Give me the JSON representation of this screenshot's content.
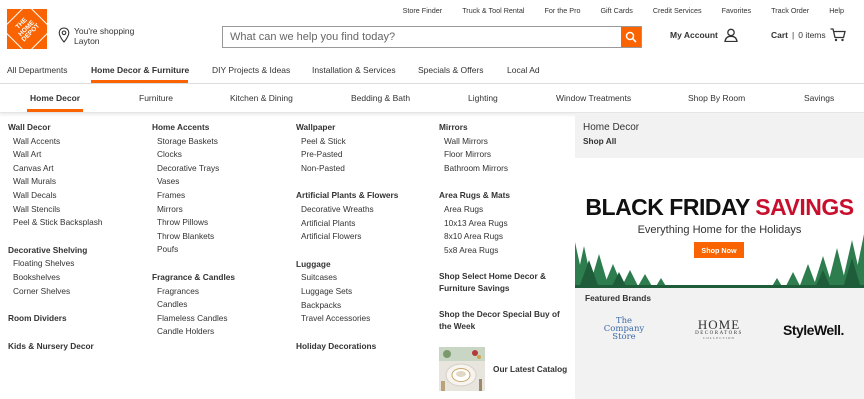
{
  "utility_nav": [
    "Store Finder",
    "Truck & Tool Rental",
    "For the Pro",
    "Gift Cards",
    "Credit Services",
    "Favorites",
    "Track Order",
    "Help"
  ],
  "logo": {
    "line1": "THE",
    "line2": "HOME",
    "line3": "DEPOT"
  },
  "store": {
    "line1": "You're shopping",
    "line2": "Layton"
  },
  "search": {
    "placeholder": "What can we help you find today?"
  },
  "account": {
    "label": "My Account"
  },
  "cart": {
    "label": "Cart",
    "items": "0 items"
  },
  "main_nav": [
    "All Departments",
    "Home Decor & Furniture",
    "DIY Projects & Ideas",
    "Installation & Services",
    "Specials & Offers",
    "Local Ad"
  ],
  "sub_nav": [
    "Home Decor",
    "Furniture",
    "Kitchen & Dining",
    "Bedding & Bath",
    "Lighting",
    "Window Treatments",
    "Shop By Room",
    "Savings"
  ],
  "menu": {
    "col1": {
      "wall_decor": {
        "title": "Wall Decor",
        "items": [
          "Wall Accents",
          "Wall Art",
          "Canvas Art",
          "Wall Murals",
          "Wall Decals",
          "Wall Stencils",
          "Peel & Stick Backsplash"
        ]
      },
      "shelving": {
        "title": "Decorative Shelving",
        "items": [
          "Floating Shelves",
          "Bookshelves",
          "Corner Shelves"
        ]
      },
      "room_dividers": "Room Dividers",
      "kids": "Kids & Nursery Decor"
    },
    "col2": {
      "home_accents": {
        "title": "Home Accents",
        "items": [
          "Storage Baskets",
          "Clocks",
          "Decorative Trays",
          "Vases",
          "Frames",
          "Mirrors",
          "Throw Pillows",
          "Throw Blankets",
          "Poufs"
        ]
      },
      "fragrance": {
        "title": "Fragrance & Candles",
        "items": [
          "Fragrances",
          "Candles",
          "Flameless Candles",
          "Candle Holders"
        ]
      }
    },
    "col3": {
      "wallpaper": {
        "title": "Wallpaper",
        "items": [
          "Peel & Stick",
          "Pre-Pasted",
          "Non-Pasted"
        ]
      },
      "plants": {
        "title": "Artificial Plants & Flowers",
        "items": [
          "Decorative Wreaths",
          "Artificial Plants",
          "Artificial Flowers"
        ]
      },
      "luggage": {
        "title": "Luggage",
        "items": [
          "Suitcases",
          "Luggage Sets",
          "Backpacks",
          "Travel Accessories"
        ]
      },
      "holiday": "Holiday Decorations"
    },
    "col4": {
      "mirrors": {
        "title": "Mirrors",
        "items": [
          "Wall Mirrors",
          "Floor Mirrors",
          "Bathroom Mirrors"
        ]
      },
      "rugs": {
        "title": "Area Rugs & Mats",
        "items": [
          "Area Rugs",
          "10x13 Area Rugs",
          "8x10 Area Rugs",
          "5x8 Area Rugs"
        ]
      },
      "select_l1": "Shop Select Home Decor &",
      "select_l2": "Furniture Savings",
      "special_l1": "Shop the Decor Special Buy of",
      "special_l2": "the Week",
      "catalog": "Our Latest Catalog"
    }
  },
  "panel": {
    "title": "Home Decor",
    "shop_all": "Shop All",
    "banner_black": "BLACK FRIDAY",
    "banner_red": "SAVINGS",
    "banner_sub": "Everything Home for the Holidays",
    "banner_btn": "Shop Now",
    "featured": "Featured Brands",
    "brand1_l1": "The",
    "brand1_l2": "Company",
    "brand1_l3": "Store",
    "brand2_l1": "HOME",
    "brand2_l2": "DECORATORS",
    "brand2_l3": "COLLECTION",
    "brand3": "StyleWell."
  },
  "colors": {
    "accent": "#f96302",
    "red": "#c8102e",
    "tree": "#2e7d4f"
  }
}
